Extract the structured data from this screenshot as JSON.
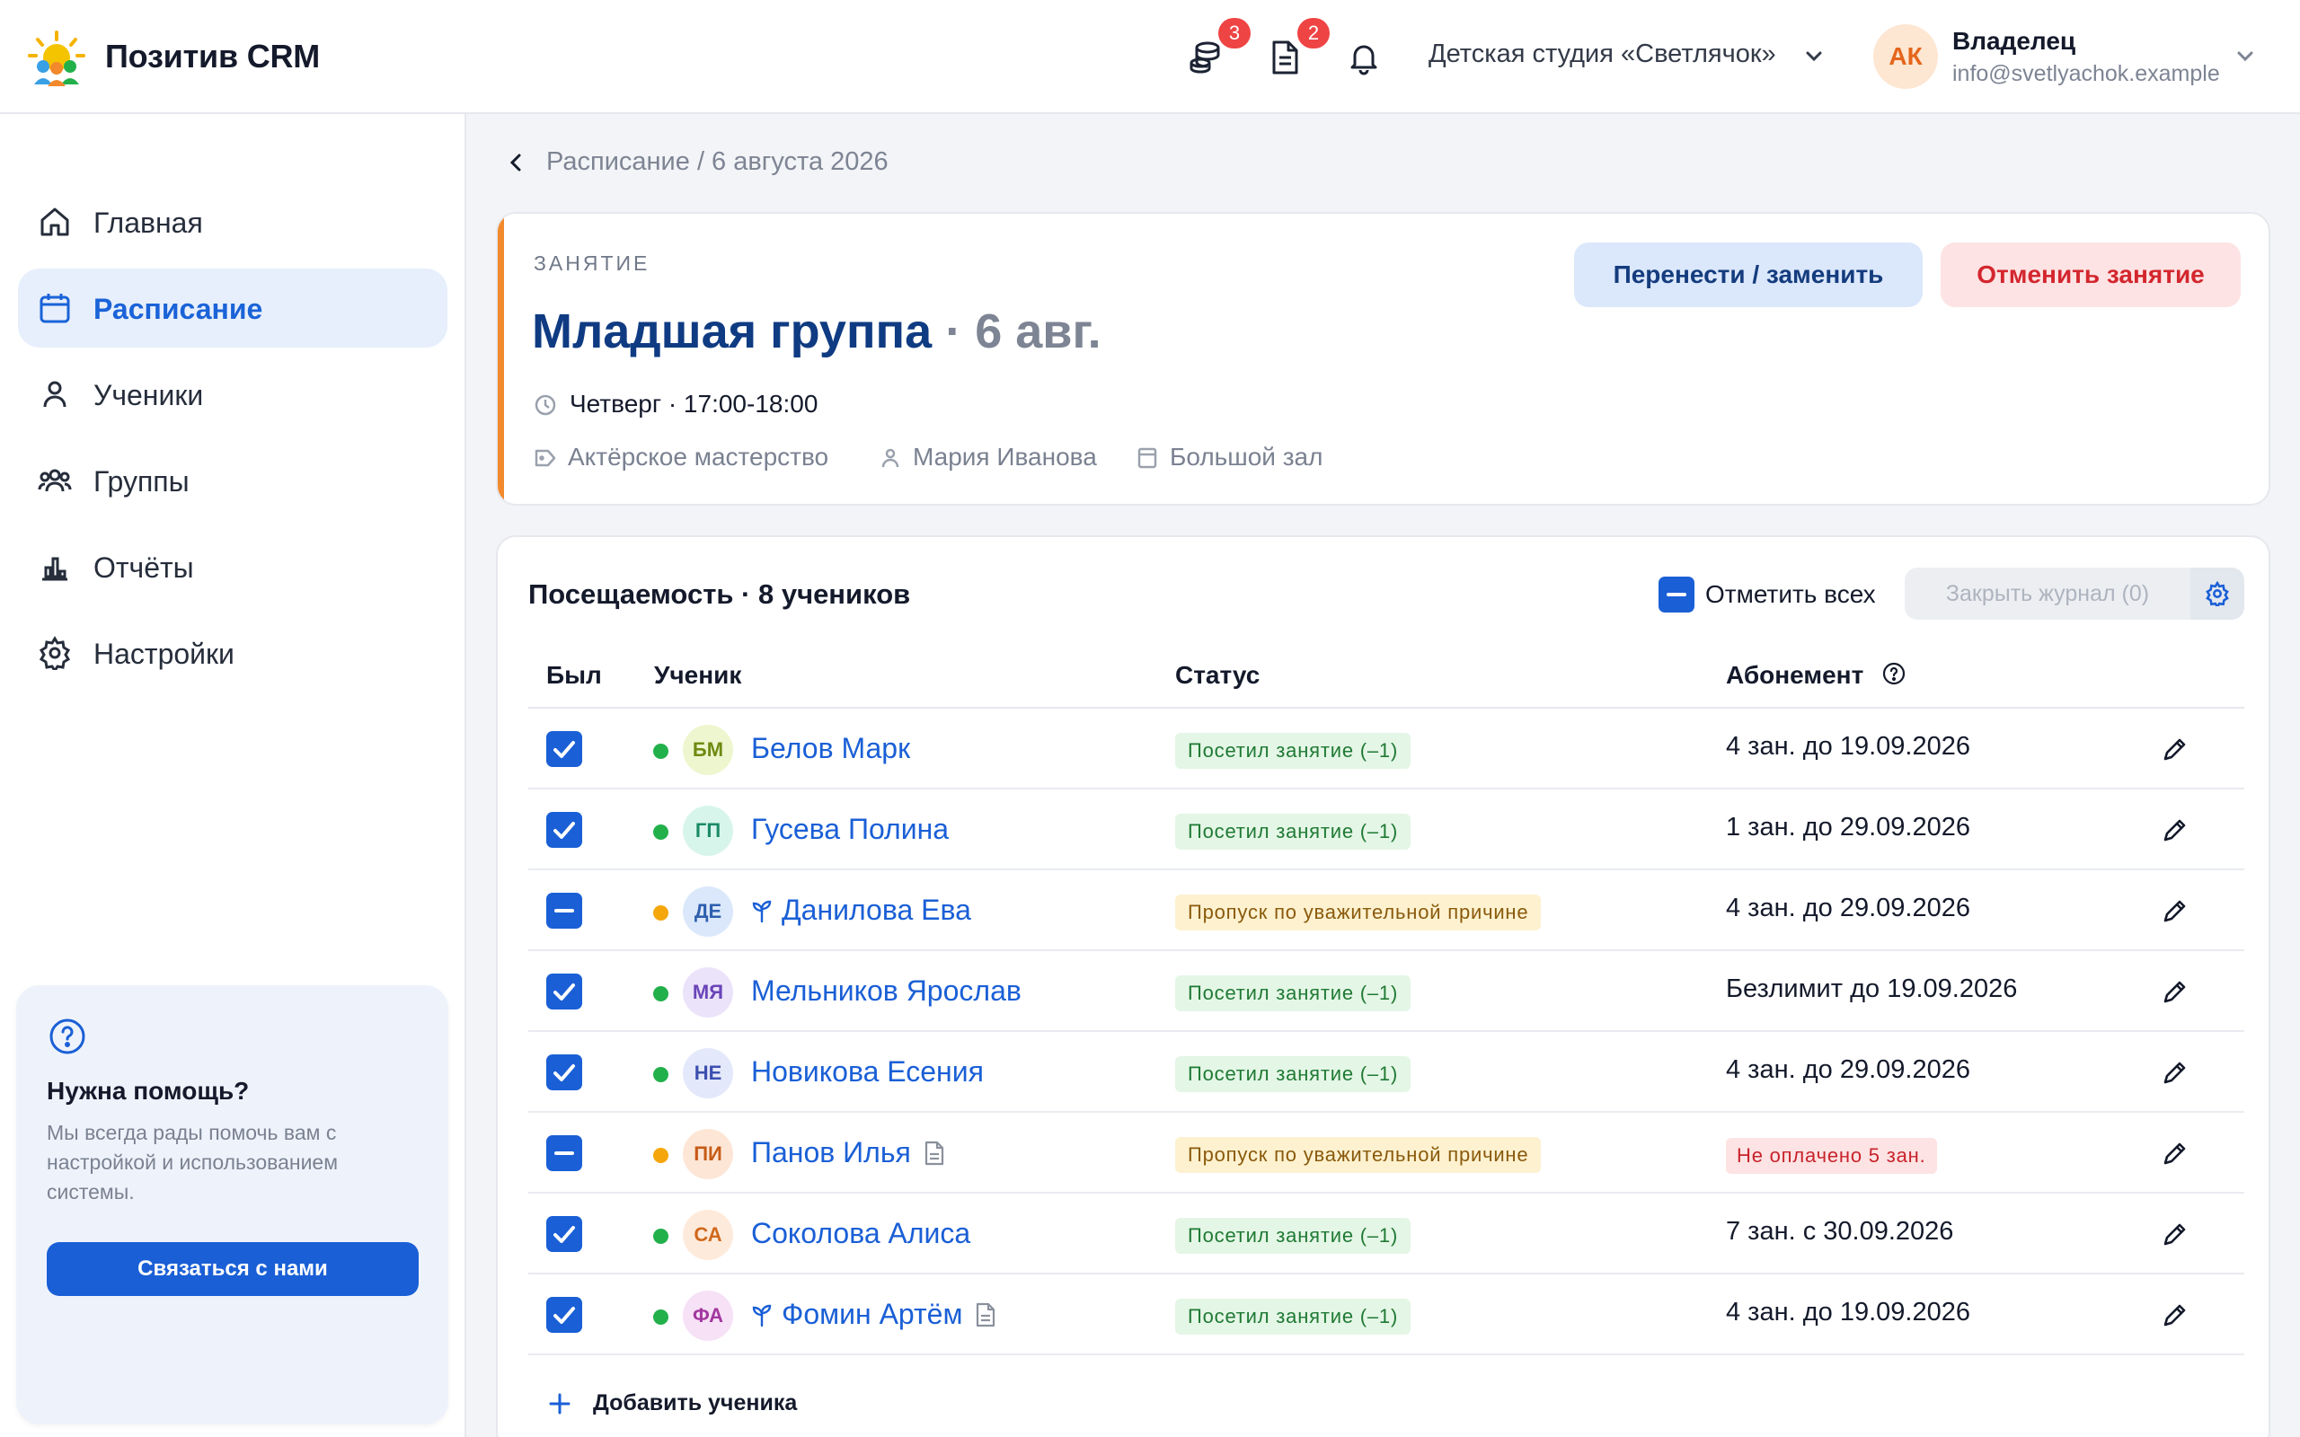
{
  "app": {
    "brand": "Позитив CRM"
  },
  "header": {
    "badges": {
      "payments": "3",
      "documents": "2"
    },
    "org_name": "Детская студия «Светлячок»",
    "user": {
      "initials": "АК",
      "role": "Владелец",
      "email": "info@svetlyachok.example"
    }
  },
  "sidebar": {
    "items": [
      {
        "label": "Главная",
        "icon": "home-icon",
        "active": false
      },
      {
        "label": "Расписание",
        "icon": "calendar-icon",
        "active": true
      },
      {
        "label": "Ученики",
        "icon": "user-icon",
        "active": false
      },
      {
        "label": "Группы",
        "icon": "users-icon",
        "active": false
      },
      {
        "label": "Отчёты",
        "icon": "chart-icon",
        "active": false
      },
      {
        "label": "Настройки",
        "icon": "gear-icon",
        "active": false
      }
    ],
    "help": {
      "title": "Нужна помощь?",
      "text": "Мы всегда рады помочь вам с настройкой и использованием системы.",
      "button": "Связаться с нами"
    }
  },
  "breadcrumb": {
    "text": "Расписание  /  6 августа 2026"
  },
  "lesson": {
    "kicker": "ЗАНЯТИЕ",
    "group": "Младшая группа",
    "date": "· 6 авг.",
    "time": "Четверг · 17:00-18:00",
    "subject": "Актёрское мастерство",
    "teacher": "Мария Иванова",
    "room": "Большой зал",
    "move_button": "Перенести / заменить",
    "cancel_button": "Отменить занятие"
  },
  "attendance": {
    "title": "Посещаемость · 8 учеников",
    "mark_all": "Отметить всех",
    "close_journal": "Закрыть журнал (0)",
    "columns": {
      "present": "Был",
      "student": "Ученик",
      "status": "Статус",
      "subscription": "Абонемент"
    },
    "add_student": "Добавить ученика",
    "colors": {
      "accent": "#1a5fd6",
      "present": "#22b04b",
      "excused": "#f5a60b"
    },
    "rows": [
      {
        "checked": "full",
        "dot": "green",
        "initials": "БМ",
        "ava_bg": "#eef6cf",
        "ava_fg": "#6f8a12",
        "name": "Белов Марк",
        "pre_icon": false,
        "doc_icon": false,
        "status": "Посетил занятие (–1)",
        "status_kind": "ok",
        "sub": "4 зан. до 19.09.2026",
        "sub_bad": false
      },
      {
        "checked": "full",
        "dot": "green",
        "initials": "ГП",
        "ava_bg": "#d8f5ec",
        "ava_fg": "#1c8a66",
        "name": "Гусева Полина",
        "pre_icon": false,
        "doc_icon": false,
        "status": "Посетил занятие (–1)",
        "status_kind": "ok",
        "sub": "1 зан. до 29.09.2026",
        "sub_bad": false
      },
      {
        "checked": "partial",
        "dot": "orange",
        "initials": "ДЕ",
        "ava_bg": "#dbe8fb",
        "ava_fg": "#2e5fae",
        "name": "Данилова Ева",
        "pre_icon": true,
        "doc_icon": false,
        "status": "Пропуск по уважительной причине",
        "status_kind": "warn",
        "sub": "4 зан. до 29.09.2026",
        "sub_bad": false
      },
      {
        "checked": "full",
        "dot": "green",
        "initials": "МЯ",
        "ava_bg": "#ebe3fa",
        "ava_fg": "#6a44b8",
        "name": "Мельников Ярослав",
        "pre_icon": false,
        "doc_icon": false,
        "status": "Посетил занятие (–1)",
        "status_kind": "ok",
        "sub": "Безлимит до 19.09.2026",
        "sub_bad": false
      },
      {
        "checked": "full",
        "dot": "green",
        "initials": "НЕ",
        "ava_bg": "#e4e8fb",
        "ava_fg": "#3b4fb0",
        "name": "Новикова Есения",
        "pre_icon": false,
        "doc_icon": false,
        "status": "Посетил занятие (–1)",
        "status_kind": "ok",
        "sub": "4 зан. до 29.09.2026",
        "sub_bad": false
      },
      {
        "checked": "partial",
        "dot": "orange",
        "initials": "ПИ",
        "ava_bg": "#fde6d6",
        "ava_fg": "#c65a16",
        "name": "Панов Илья",
        "pre_icon": false,
        "doc_icon": true,
        "status": "Пропуск по уважительной причине",
        "status_kind": "warn",
        "sub": "Не оплачено 5 зан.",
        "sub_bad": true
      },
      {
        "checked": "full",
        "dot": "green",
        "initials": "СА",
        "ava_bg": "#feeadb",
        "ava_fg": "#d0681b",
        "name": "Соколова Алиса",
        "pre_icon": false,
        "doc_icon": false,
        "status": "Посетил занятие (–1)",
        "status_kind": "ok",
        "sub": "7 зан. с 30.09.2026",
        "sub_bad": false
      },
      {
        "checked": "full",
        "dot": "green",
        "initials": "ФА",
        "ava_bg": "#f6e1f6",
        "ava_fg": "#a2379f",
        "name": "Фомин Артём",
        "pre_icon": true,
        "doc_icon": true,
        "status": "Посетил занятие (–1)",
        "status_kind": "ok",
        "sub": "4 зан. до 19.09.2026",
        "sub_bad": false
      }
    ]
  }
}
